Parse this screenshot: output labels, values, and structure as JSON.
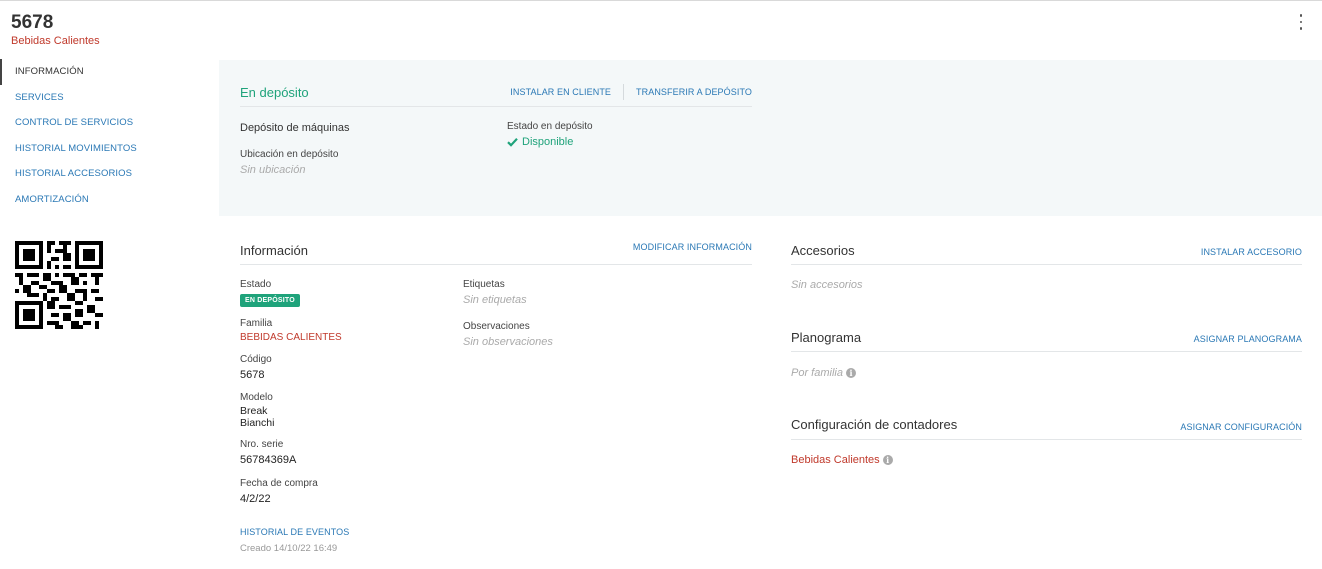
{
  "header": {
    "title": "5678",
    "subtitle": "Bebidas Calientes"
  },
  "sidebar": {
    "items": [
      {
        "label": "INFORMACIÓN",
        "active": true
      },
      {
        "label": "SERVICES"
      },
      {
        "label": "CONTROL DE SERVICIOS"
      },
      {
        "label": "HISTORIAL MOVIMIENTOS"
      },
      {
        "label": "HISTORIAL ACCESORIOS"
      },
      {
        "label": "AMORTIZACIÓN"
      }
    ]
  },
  "deposit": {
    "title": "En depósito",
    "install_client": "INSTALAR EN CLIENTE",
    "transfer_deposit": "TRANSFERIR A DEPÓSITO",
    "deposit_name": "Depósito de máquinas",
    "location_label": "Ubicación en depósito",
    "location_value": "Sin ubicación",
    "state_label": "Estado en depósito",
    "state_value": "Disponible"
  },
  "info": {
    "title": "Información",
    "modify": "MODIFICAR INFORMACIÓN",
    "estado_label": "Estado",
    "estado_badge": "EN DEPÓSITO",
    "familia_label": "Familia",
    "familia_value": "BEBIDAS CALIENTES",
    "codigo_label": "Código",
    "codigo_value": "5678",
    "modelo_label": "Modelo",
    "modelo_line1": "Break",
    "modelo_line2": "Bianchi",
    "serie_label": "Nro. serie",
    "serie_value": "56784369A",
    "compra_label": "Fecha de compra",
    "compra_value": "4/2/22",
    "etiquetas_label": "Etiquetas",
    "etiquetas_value": "Sin etiquetas",
    "observaciones_label": "Observaciones",
    "observaciones_value": "Sin observaciones",
    "history_link": "HISTORIAL DE EVENTOS",
    "created": "Creado 14/10/22 16:49"
  },
  "accesorios": {
    "title": "Accesorios",
    "action": "INSTALAR ACCESORIO",
    "empty": "Sin accesorios"
  },
  "planograma": {
    "title": "Planograma",
    "action": "ASIGNAR PLANOGRAMA",
    "value": "Por familia"
  },
  "contadores": {
    "title": "Configuración de contadores",
    "action": "ASIGNAR CONFIGURACIÓN",
    "value": "Bebidas Calientes"
  },
  "colors": {
    "accent_link": "#2a78b5",
    "success": "#1fa37b",
    "danger_text": "#c0392b",
    "panel_bg": "#f4f8f9"
  },
  "icons": {
    "menu": "kebab-vertical-icon",
    "check": "check-icon",
    "info": "info-circle-icon",
    "qr": "qr-code"
  }
}
